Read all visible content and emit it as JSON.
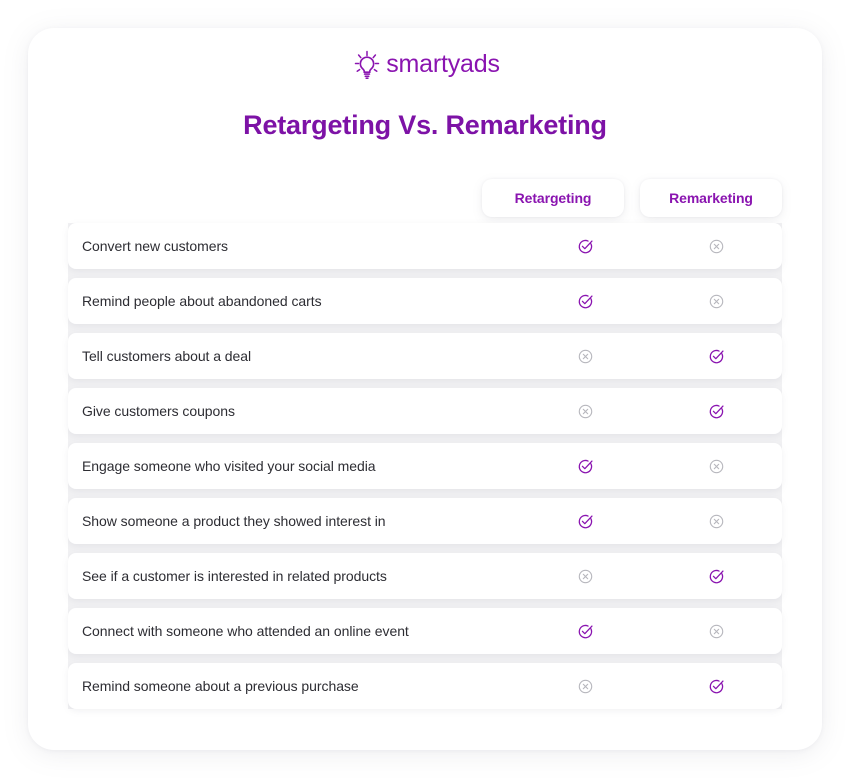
{
  "brand": {
    "logo_icon": "lightbulb-icon",
    "logo_text": "smartyads",
    "purple": "#8a14b0",
    "title_purple": "#7d12a6"
  },
  "header": {
    "title": "Retargeting Vs. Remarketing"
  },
  "table": {
    "columns": [
      {
        "key": "label",
        "label": ""
      },
      {
        "key": "retargeting",
        "label": "Retargeting"
      },
      {
        "key": "remarketing",
        "label": "Remarketing"
      }
    ],
    "icons": {
      "yes": "circle-check-icon",
      "no": "circle-x-icon"
    },
    "rows": [
      {
        "label": "Convert new customers",
        "retargeting": "yes",
        "remarketing": "no"
      },
      {
        "label": "Remind people about abandoned carts",
        "retargeting": "yes",
        "remarketing": "no"
      },
      {
        "label": "Tell customers about a deal",
        "retargeting": "no",
        "remarketing": "yes"
      },
      {
        "label": "Give customers coupons",
        "retargeting": "no",
        "remarketing": "yes"
      },
      {
        "label": "Engage someone who visited your social media",
        "retargeting": "yes",
        "remarketing": "no"
      },
      {
        "label": "Show someone a product they showed interest in",
        "retargeting": "yes",
        "remarketing": "no"
      },
      {
        "label": "See if a customer is interested in related products",
        "retargeting": "no",
        "remarketing": "yes"
      },
      {
        "label": "Connect with someone who attended an online event",
        "retargeting": "yes",
        "remarketing": "no"
      },
      {
        "label": "Remind someone about a previous purchase",
        "retargeting": "no",
        "remarketing": "yes"
      }
    ]
  }
}
